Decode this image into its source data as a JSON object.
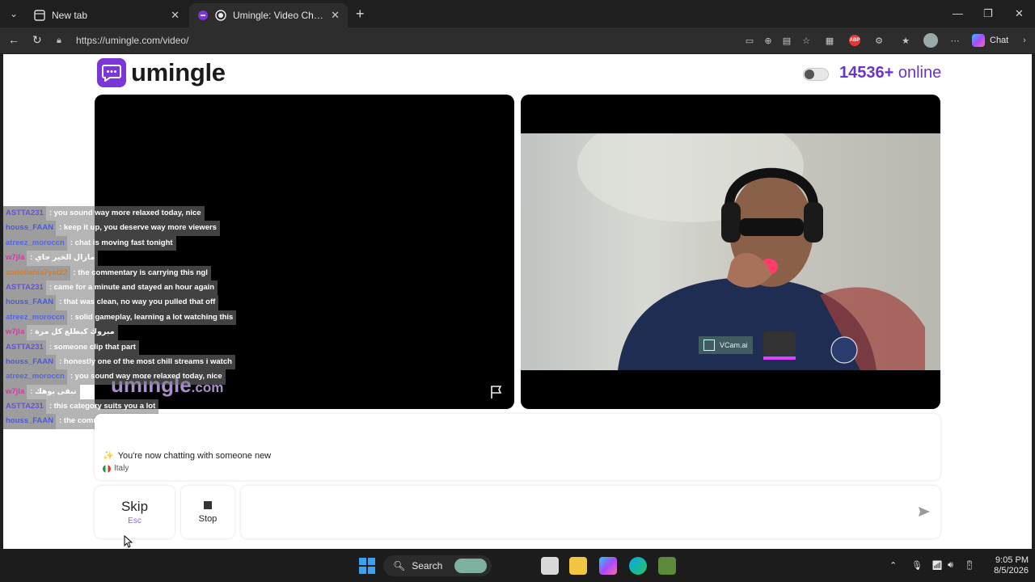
{
  "browser": {
    "tabs": [
      {
        "title": "New tab",
        "active": false,
        "favicon": "page-icon"
      },
      {
        "title": "Umingle: Video Chat with Stra",
        "active": true,
        "favicon": "umingle-icon"
      }
    ],
    "url": "https://umingle.com/video/",
    "chat_button_label": "Chat"
  },
  "site": {
    "logo_text": "umingle",
    "online_count": "14536+",
    "online_label": "online",
    "watermark": "umingle",
    "watermark_suffix": ".com",
    "vcam_badge": "VCam.ai"
  },
  "overlay_chat": [
    {
      "user": "ASTTA231",
      "user_color": "#6b4fd6",
      "msg": ": you sound way more relaxed today, nice"
    },
    {
      "user": "houss_FAAN",
      "user_color": "#4a5bd8",
      "msg": ": keep it up, you deserve way more viewers"
    },
    {
      "user": "atreez_moroccn",
      "user_color": "#5566dd",
      "msg": ": chat is moving fast tonight"
    },
    {
      "user": "w7jla",
      "user_color": "#d23aa8",
      "msg": ": مازال الخير جاي"
    },
    {
      "user": "abdollahia7yat22",
      "user_color": "#e07a1a",
      "msg": ": the commentary is carrying this ngl"
    },
    {
      "user": "ASTTA231",
      "user_color": "#6b4fd6",
      "msg": ": came for a minute and stayed an hour again"
    },
    {
      "user": "houss_FAAN",
      "user_color": "#4a5bd8",
      "msg": ": that was clean, no way you pulled that off"
    },
    {
      "user": "atreez_moroccn",
      "user_color": "#5566dd",
      "msg": ": solid gameplay, learning a lot watching this"
    },
    {
      "user": "w7jla",
      "user_color": "#d23aa8",
      "msg": ": مبروك كيطلع كل مرة"
    },
    {
      "user": "ASTTA231",
      "user_color": "#6b4fd6",
      "msg": ": someone clip that part"
    },
    {
      "user": "houss_FAAN",
      "user_color": "#4a5bd8",
      "msg": ": honestly one of the most chill streams i watch"
    },
    {
      "user": "atreez_moroccn",
      "user_color": "#5566dd",
      "msg": ": you sound way more relaxed today, nice"
    },
    {
      "user": "w7jla",
      "user_color": "#d23aa8",
      "msg": ": تبقى بوهك"
    },
    {
      "user": "ASTTA231",
      "user_color": "#6b4fd6",
      "msg": ": this category suits you a lot"
    },
    {
      "user": "houss_FAAN",
      "user_color": "#4a5bd8",
      "msg": ": the commentary is carrying this ngl"
    }
  ],
  "chat": {
    "system_message": "You're now chatting with someone new",
    "country": "Italy"
  },
  "controls": {
    "skip_label": "Skip",
    "skip_key": "Esc",
    "stop_label": "Stop"
  },
  "taskbar": {
    "search_label": "Search",
    "time": "9:05 PM",
    "date": "8/5/2026"
  },
  "colors": {
    "brand_purple": "#7a36d6",
    "online_purple": "#6a34c9"
  }
}
